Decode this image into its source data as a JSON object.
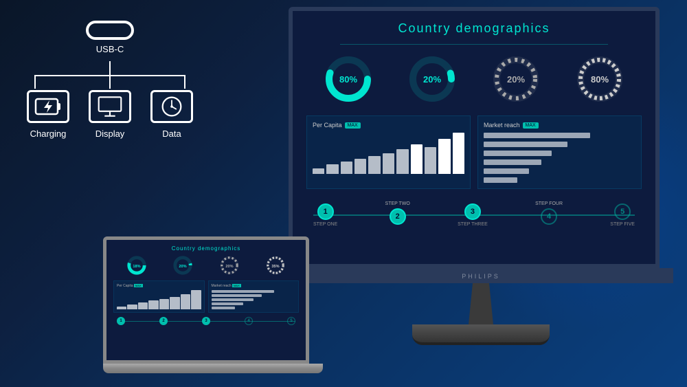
{
  "left": {
    "connector_label": "USB-C",
    "features": [
      {
        "id": "charging",
        "label": "Charging",
        "icon": "⚡"
      },
      {
        "id": "display",
        "label": "Display",
        "icon": "🖥"
      },
      {
        "id": "data",
        "label": "Data",
        "icon": "🕐"
      }
    ]
  },
  "dashboard": {
    "title": "Country demographics",
    "donuts": [
      {
        "pct": 80,
        "label": "80%",
        "color": "#00e5d0",
        "bg": "rgba(0,229,208,0.15)"
      },
      {
        "pct": 20,
        "label": "20%",
        "color": "#00e5d0",
        "bg": "rgba(0,229,208,0.15)"
      },
      {
        "pct": 20,
        "label": "20%",
        "color": "#ccc",
        "bg": "rgba(200,200,200,0.1)"
      },
      {
        "pct": 80,
        "label": "80%",
        "color": "#ccc",
        "bg": "rgba(200,200,200,0.1)"
      }
    ],
    "per_capita": {
      "title": "Per Capita",
      "bars": [
        5,
        10,
        13,
        16,
        19,
        22,
        26,
        30,
        28,
        35,
        40
      ]
    },
    "market_reach": {
      "title": "Market reach",
      "bars": [
        70,
        55,
        45,
        38,
        30,
        25
      ]
    },
    "steps": [
      {
        "num": "1",
        "top": "",
        "bot": "STEP ONE",
        "active": true
      },
      {
        "num": "2",
        "top": "STEP TWO",
        "bot": "",
        "active": true
      },
      {
        "num": "3",
        "top": "",
        "bot": "STEP THREE",
        "active": true
      },
      {
        "num": "4",
        "top": "STEP FOUR",
        "bot": "",
        "active": false
      },
      {
        "num": "5",
        "top": "",
        "bot": "STEP FIVE",
        "active": false
      }
    ]
  },
  "monitor": {
    "brand": "PHILIPS"
  },
  "colors": {
    "teal": "#00e5d0",
    "dark_navy": "#0d1b3e",
    "accent": "#00bfae"
  }
}
